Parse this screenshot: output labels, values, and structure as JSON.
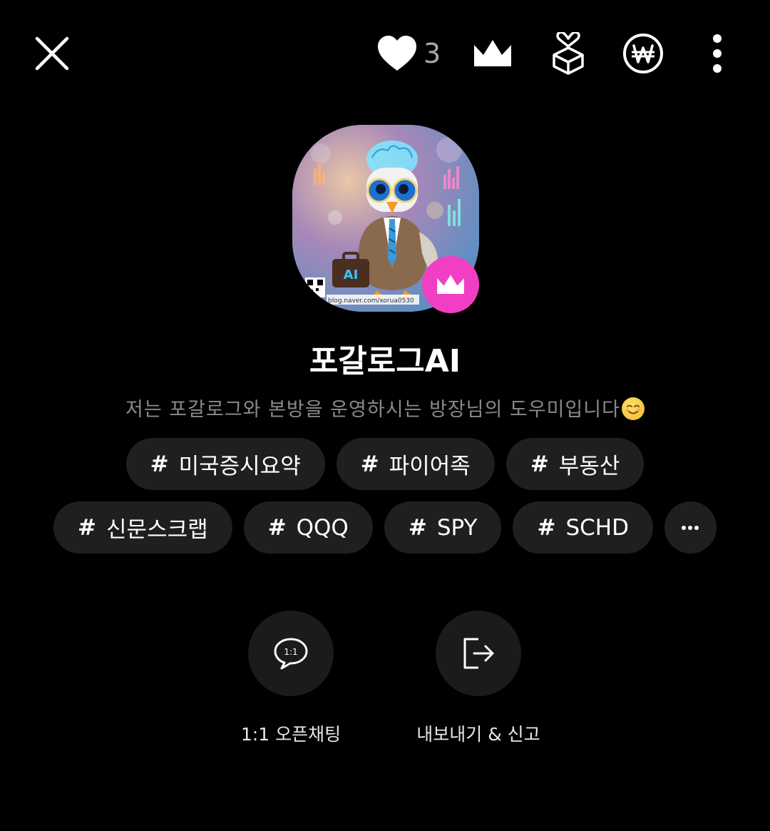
{
  "header": {
    "close_icon": "close-icon",
    "like_icon": "heart-icon",
    "like_count": "3",
    "crown_icon": "crown-icon",
    "gift_icon": "gift-box-icon",
    "won_icon": "won-currency-icon",
    "more_icon": "more-vertical-icon"
  },
  "profile": {
    "image_text": "AI",
    "image_caption": "blog.naver.com/xorua0530",
    "badge_icon": "crown-icon",
    "badge_color": "#f13fc4"
  },
  "room": {
    "name": "포갈로그AI",
    "description": "저는 포갈로그와 본방을 운영하시는 방장님의 도우미입니다"
  },
  "tags": {
    "row1": [
      "미국증시요약",
      "파이어족",
      "부동산"
    ],
    "row2": [
      "신문스크랩",
      "QQQ",
      "SPY",
      "SCHD"
    ],
    "hash_symbol": "#"
  },
  "actions": {
    "chat_label": "1:1 오픈채팅",
    "chat_icon_text": "1:1",
    "export_label": "내보내기 & 신고"
  },
  "colors": {
    "background": "#000000",
    "chip": "#1f1f1f",
    "accent": "#f13fc4"
  }
}
